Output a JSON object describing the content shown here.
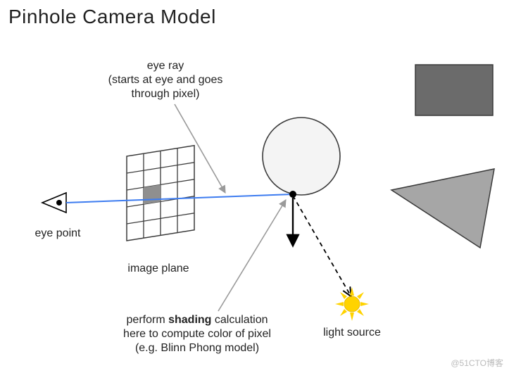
{
  "title": "Pinhole Camera Model",
  "labels": {
    "eye_ray_l1": "eye ray",
    "eye_ray_l2": "(starts at eye and goes",
    "eye_ray_l3": "through pixel)",
    "eye_point": "eye point",
    "image_plane": "image plane",
    "light_source": "light source",
    "shading_l1_prefix": "perform ",
    "shading_l1_bold": "shading",
    "shading_l1_suffix": " calculation",
    "shading_l2": "here to compute color of pixel",
    "shading_l3": "(e.g. Blinn Phong model)"
  },
  "watermark": "@51CTO博客",
  "colors": {
    "ray": "#3d7cf0",
    "callout": "#9a9a9a",
    "sphere_fill": "#f4f4f4",
    "grid_stroke": "#3a3a3a",
    "pixel_fill": "#8f8f8f",
    "rect_fill": "#6b6b6b",
    "tri_fill": "#a6a6a6",
    "sun_fill": "#ffd300"
  }
}
